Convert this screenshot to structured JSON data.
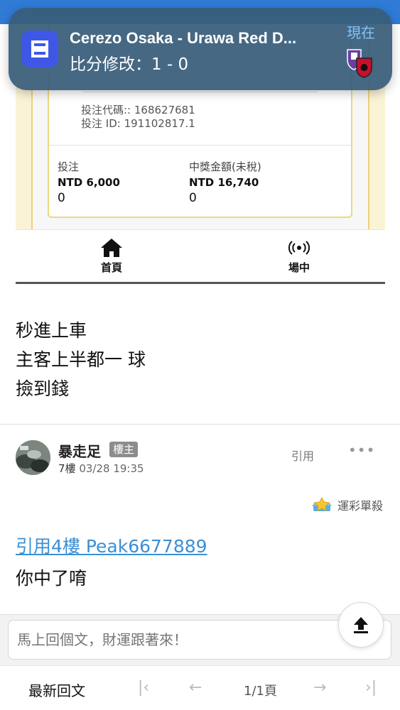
{
  "notification": {
    "title": "Cerezo Osaka - Urawa Red D...",
    "subtitle": "比分修改：1 - 0",
    "time": "現在"
  },
  "bet_slip": {
    "code": "投注代碼:: 168627681",
    "bet_id": "投注 ID: 191102817.1",
    "stake_label": "投注",
    "stake_amount": "NTD 6,000",
    "stake_extra": "0",
    "payout_label": "中獎金額(未稅)",
    "payout_amount": "NTD 16,740",
    "payout_extra": "0"
  },
  "embed_nav": {
    "home": "首頁",
    "live": "場中"
  },
  "post": {
    "lines": [
      "秒進上車",
      "主客上半都一 球",
      "撿到錢"
    ]
  },
  "reply": {
    "author": "暴走足",
    "badge": "樓主",
    "floor": "7樓",
    "time": "03/28 19:35",
    "quote_label": "引用",
    "more": "•••",
    "rank_label": "運彩單殺",
    "quote_link": "引用4樓 Peak6677889",
    "text": "你中了唷"
  },
  "composer": {
    "placeholder": "馬上回個文，財運跟著來！"
  },
  "pager": {
    "latest": "最新回文",
    "first": "|‹",
    "prev": "←",
    "page": "1/1頁",
    "next": "→",
    "last": "›|"
  }
}
